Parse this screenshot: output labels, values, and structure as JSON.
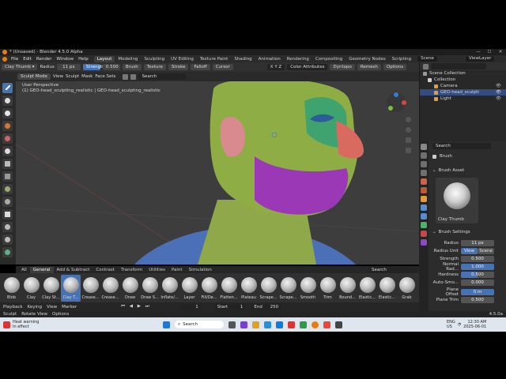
{
  "window": {
    "title": "* (Unsaved) - Blender 4.5.0 Alpha",
    "min": "—",
    "max": "☐",
    "close": "✕"
  },
  "menu": [
    "File",
    "Edit",
    "Render",
    "Window",
    "Help"
  ],
  "workspaces": [
    "Layout",
    "Modeling",
    "Sculpting",
    "UV Editing",
    "Texture Paint",
    "Shading",
    "Animation",
    "Rendering",
    "Compositing",
    "Geometry Nodes",
    "Scripting"
  ],
  "scene": {
    "name": "Scene",
    "view_layer": "ViewLayer"
  },
  "toolbar": {
    "brush_name": "Clay Thumb",
    "radius_label": "Radius",
    "radius_value": "11 px",
    "strength_label": "Strength",
    "strength_value": "0.500",
    "brush": "Brush",
    "texture": "Texture",
    "stroke": "Stroke",
    "falloff": "Falloff",
    "cursor": "Cursor",
    "xyz": "X  Y  Z",
    "color_attr": "Color Attributes",
    "dyntopo": "Dyntopo",
    "remesh": "Remesh",
    "options": "Options"
  },
  "viewport_header": {
    "mode": "Sculpt Mode",
    "view": "View",
    "sculpt": "Sculpt",
    "mask": "Mask",
    "face_sets": "Face Sets",
    "search_placeholder": "Search"
  },
  "viewport": {
    "line1": "User Perspective",
    "line2": "(1) GEO-head_sculpting_realistic | GEO-head_sculpting_realistic"
  },
  "outliner": {
    "search_placeholder": "",
    "items": [
      {
        "label": "Scene Collection",
        "indent": 0,
        "color": "#9a9a9a"
      },
      {
        "label": "Collection",
        "indent": 1,
        "color": "#d0d0d0"
      },
      {
        "label": "Camera",
        "indent": 2,
        "color": "#e59a3c"
      },
      {
        "label": "GEO-head_sculpti",
        "indent": 2,
        "color": "#e59a3c"
      },
      {
        "label": "Light",
        "indent": 2,
        "color": "#e59a3c"
      }
    ]
  },
  "properties": {
    "search_placeholder": "Search",
    "brush_label": "Brush",
    "brush_asset_header": "Brush Asset",
    "asset_name": "Clay Thumb",
    "brush_settings_header": "Brush Settings",
    "radius_label": "Radius",
    "radius_value": "11 px",
    "radius_unit_label": "Radius Unit",
    "view": "View",
    "scene": "Scene",
    "strength_label": "Strength",
    "strength_value": "0.500",
    "normal_radius_label": "Normal Rad...",
    "normal_radius_value": "1.000",
    "hardness_label": "Hardness",
    "hardness_value": "0.500",
    "auto_smooth_label": "Auto-Smo...",
    "auto_smooth_value": "0.000",
    "plane_offset_label": "Plane Offset",
    "plane_offset_value": "0 m",
    "plane_trim_label": "Plane Trim",
    "plane_trim_value": "0.500"
  },
  "shelf": {
    "tabs": [
      "All",
      "General",
      "Add & Subtract",
      "Contrast",
      "Transform",
      "Utilities",
      "Paint",
      "Simulation"
    ],
    "search_placeholder": "Search",
    "brushes": [
      "Blob",
      "Clay",
      "Clay St...",
      "Clay T...",
      "Crease...",
      "Crease...",
      "Draw",
      "Draw S...",
      "Inflate/...",
      "Layer",
      "Fill/De...",
      "Flatten...",
      "Plateau",
      "Scrape...",
      "Scrape...",
      "Smooth",
      "Trim",
      "Bound...",
      "Elastic...",
      "Elastic...",
      "Grab"
    ]
  },
  "timeline": {
    "playback": "Playback",
    "keying": "Keying",
    "view": "View",
    "marker": "Marker",
    "current_frame": "1",
    "start_label": "Start",
    "start": "1",
    "end_label": "End",
    "end": "250"
  },
  "status": {
    "left1": "Sculpt",
    "left2": "Rotate View",
    "left3": "Options",
    "version": "4.5.0a"
  },
  "taskbar": {
    "warning_line1": "Heat warning",
    "warning_line2": "In effect",
    "search_placeholder": "Search",
    "lang1": "ENG",
    "lang2": "US",
    "time": "12:30 AM",
    "date": "2025-06-01"
  }
}
